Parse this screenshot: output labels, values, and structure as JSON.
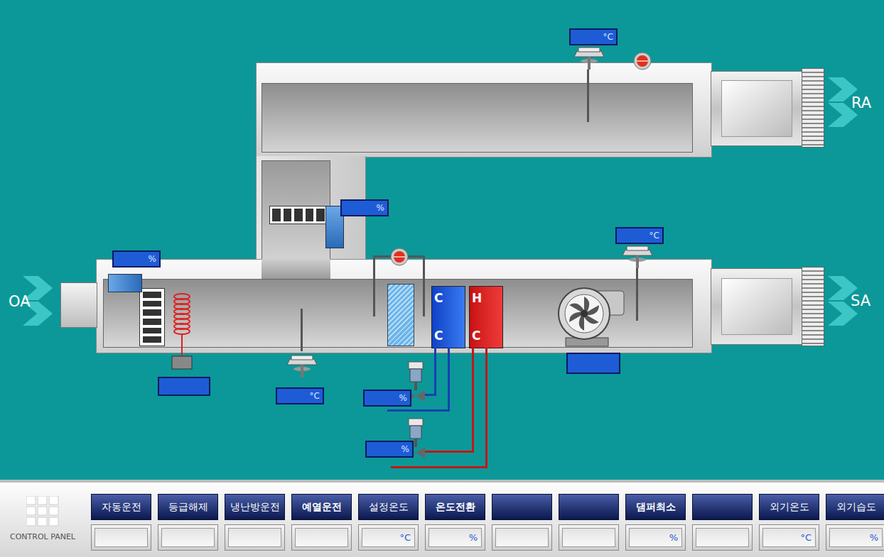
{
  "return_air": {
    "label": "RA",
    "temp_unit": "°C",
    "lamp_color": "#e0301e"
  },
  "return_damper": {
    "unit": "%"
  },
  "outdoor_air": {
    "label": "OA",
    "damper_unit": "%"
  },
  "supply_air": {
    "label": "SA",
    "temp_unit": "°C"
  },
  "mixed_air": {
    "temp_unit": "°C"
  },
  "filter": {
    "lamp_color": "#e0301e"
  },
  "cooling_coil": {
    "letters": [
      "C",
      "C"
    ],
    "valve_unit": "%"
  },
  "heating_coil": {
    "letters": [
      "H",
      "C"
    ],
    "valve_unit": "%"
  },
  "preheater": {
    "reading": ""
  },
  "fan": {
    "reading": ""
  },
  "control_panel": {
    "title": "CONTROL PANEL",
    "buttons": [
      {
        "label": "자동운전",
        "bold": false,
        "unit": ""
      },
      {
        "label": "등급해제",
        "bold": false,
        "unit": ""
      },
      {
        "label": "냉난방운전",
        "bold": false,
        "unit": ""
      },
      {
        "label": "예열운전",
        "bold": true,
        "unit": ""
      },
      {
        "label": "설정온도",
        "bold": false,
        "unit": "°C"
      },
      {
        "label": "온도전환",
        "bold": true,
        "unit": "%"
      },
      {
        "label": "",
        "bold": false,
        "unit": ""
      },
      {
        "label": "",
        "bold": false,
        "unit": ""
      },
      {
        "label": "댐퍼최소",
        "bold": true,
        "unit": "%"
      },
      {
        "label": "",
        "bold": false,
        "unit": ""
      },
      {
        "label": "외기온도",
        "bold": false,
        "unit": "°C"
      },
      {
        "label": "외기습도",
        "bold": false,
        "unit": "%"
      }
    ]
  }
}
